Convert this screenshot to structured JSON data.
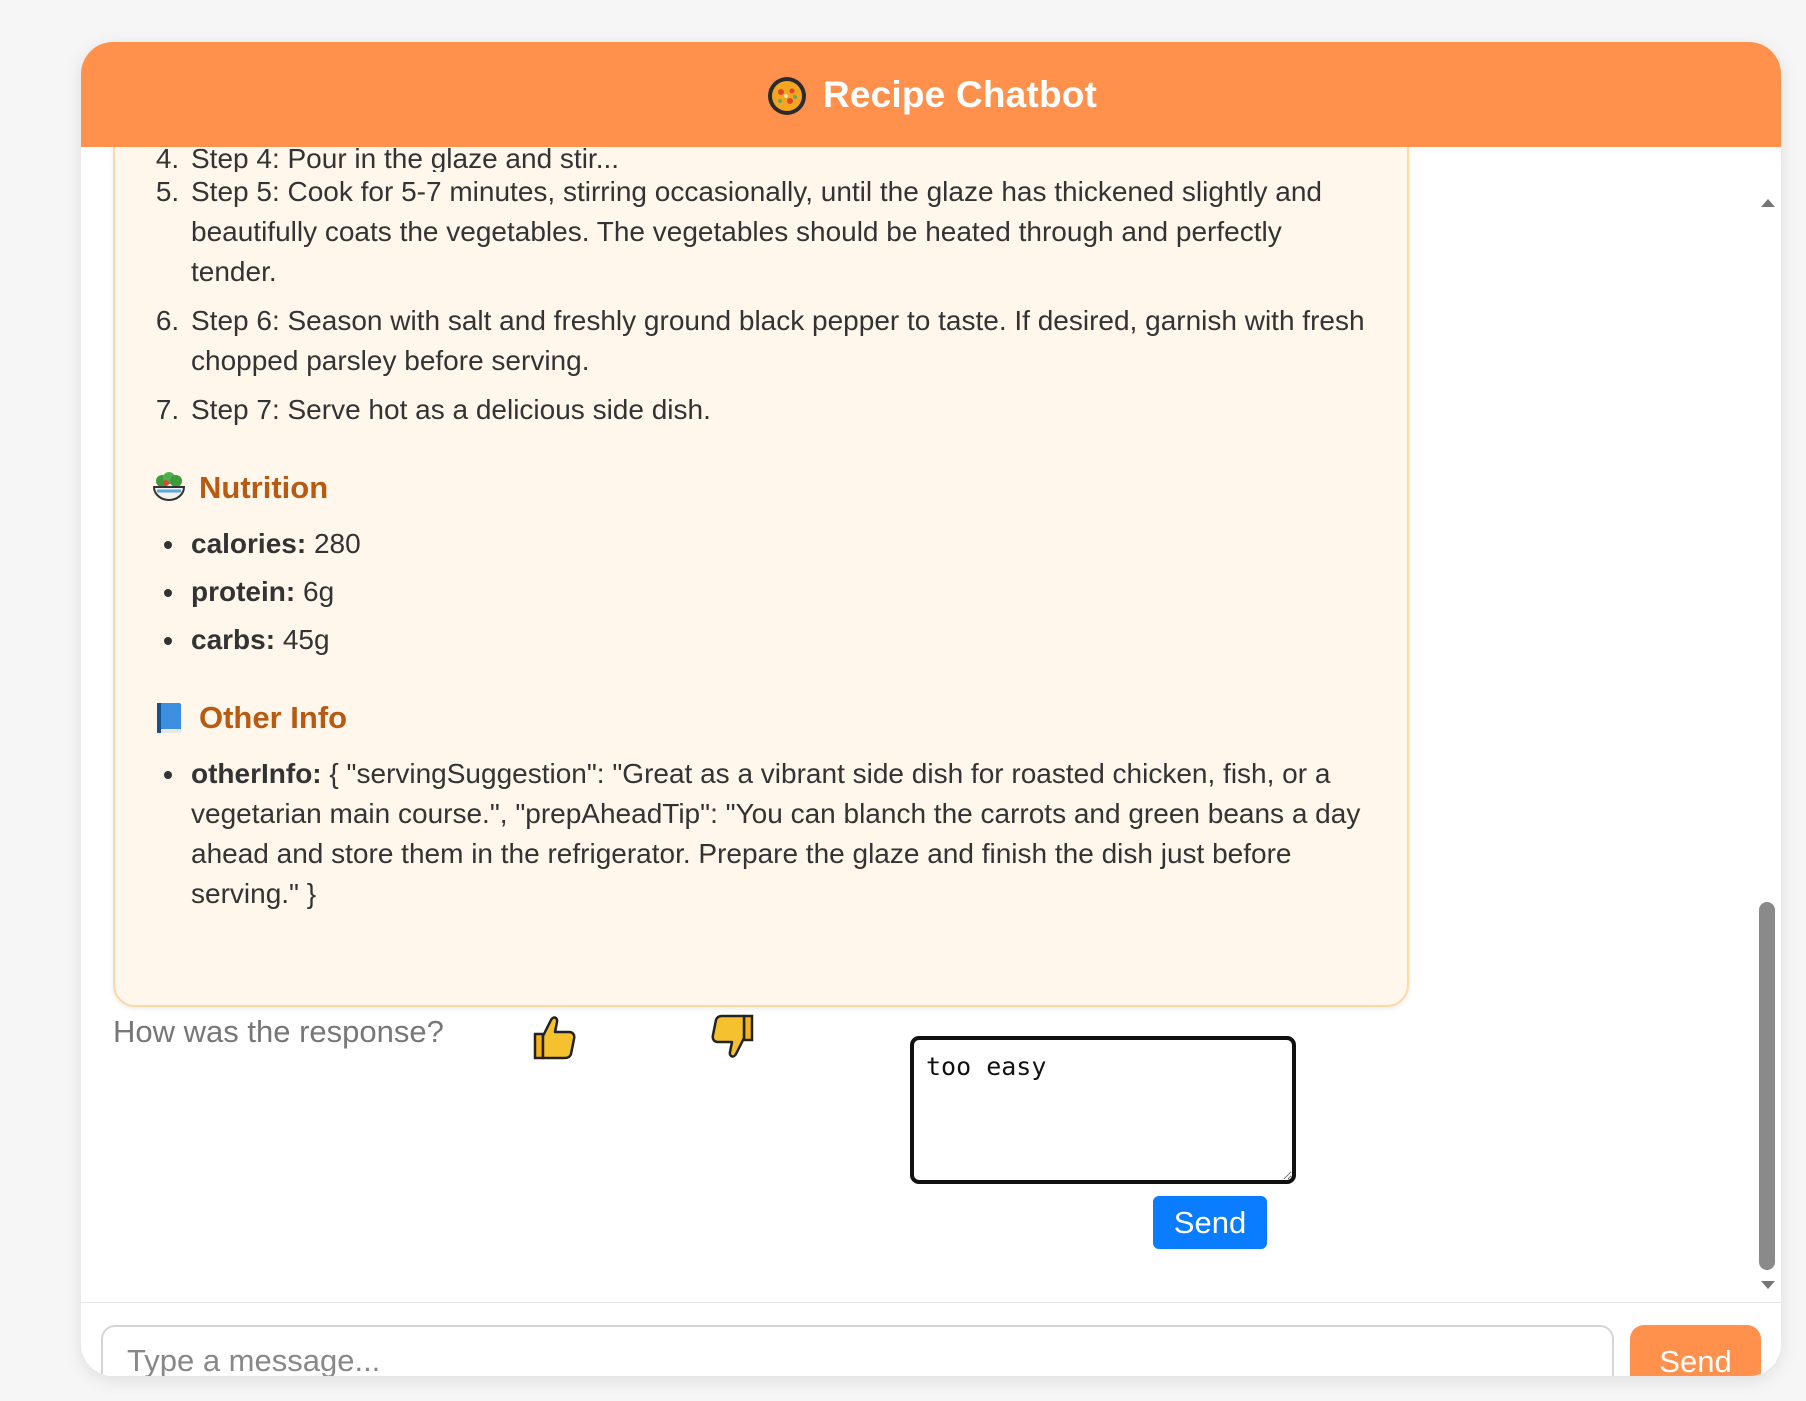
{
  "header": {
    "title": "Recipe Chatbot",
    "icon": "paella-pan-icon"
  },
  "recipe": {
    "clipped_step_text": "Step 4: Pour in the glaze and stir...",
    "steps": [
      {
        "number": "5.",
        "text": "Step 5: Cook for 5-7 minutes, stirring occasionally, until the glaze has thickened slightly and beautifully coats the vegetables. The vegetables should be heated through and perfectly tender."
      },
      {
        "number": "6.",
        "text": "Step 6: Season with salt and freshly ground black pepper to taste. If desired, garnish with fresh chopped parsley before serving."
      },
      {
        "number": "7.",
        "text": "Step 7: Serve hot as a delicious side dish."
      }
    ],
    "nutrition": {
      "title": "Nutrition",
      "icon": "salad-bowl-icon",
      "items": [
        {
          "key": "calories:",
          "value": " 280"
        },
        {
          "key": "protein:",
          "value": " 6g"
        },
        {
          "key": "carbs:",
          "value": " 45g"
        }
      ]
    },
    "other_info": {
      "title": "Other Info",
      "icon": "blue-book-icon",
      "items": [
        {
          "key": "otherInfo:",
          "value": " { \"servingSuggestion\": \"Great as a vibrant side dish for roasted chicken, fish, or a vegetarian main course.\", \"prepAheadTip\": \"You can blanch the carrots and green beans a day ahead and store them in the refrigerator. Prepare the glaze and finish the dish just before serving.\" }"
        }
      ]
    }
  },
  "feedback": {
    "label": "How was the response?",
    "thumbs_up_icon": "thumbs-up-icon",
    "thumbs_down_icon": "thumbs-down-icon",
    "comment_value": "too easy",
    "send_label": "Send"
  },
  "composer": {
    "placeholder": "Type a message...",
    "send_label": "Send"
  },
  "colors": {
    "header": "#ff914d",
    "bubble_bg": "#fff6ec",
    "section_title": "#b85a12",
    "feedback_send": "#0a7cff"
  }
}
